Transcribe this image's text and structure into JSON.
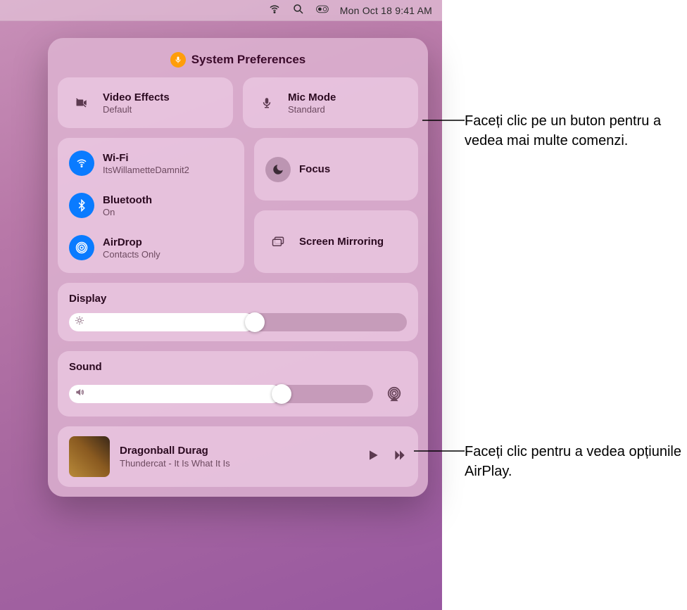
{
  "menubar": {
    "datetime": "Mon Oct 18  9:41 AM"
  },
  "header": {
    "app": "System Preferences"
  },
  "videoEffects": {
    "title": "Video Effects",
    "subtitle": "Default"
  },
  "micMode": {
    "title": "Mic Mode",
    "subtitle": "Standard"
  },
  "wifi": {
    "title": "Wi-Fi",
    "subtitle": "ItsWillametteDamnit2"
  },
  "bluetooth": {
    "title": "Bluetooth",
    "subtitle": "On"
  },
  "airdrop": {
    "title": "AirDrop",
    "subtitle": "Contacts Only"
  },
  "focus": {
    "title": "Focus"
  },
  "screenMirroring": {
    "title": "Screen Mirroring"
  },
  "display": {
    "title": "Display",
    "value": 55
  },
  "sound": {
    "title": "Sound",
    "value": 70
  },
  "nowPlaying": {
    "track": "Dragonball Durag",
    "artist": "Thundercat - It Is What It Is"
  },
  "annotations": {
    "callout1": "Faceți clic pe un buton pentru a vedea mai multe comenzi.",
    "callout2": "Faceți clic pentru a vedea opțiunile AirPlay."
  }
}
